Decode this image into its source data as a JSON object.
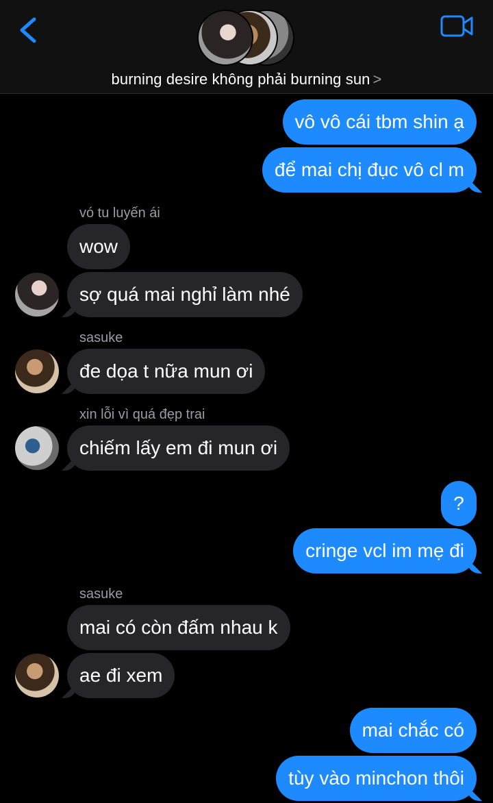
{
  "header": {
    "title": "burning desire không phải burning sun",
    "chevron": ">",
    "back_icon": "chevron-left-icon",
    "video_icon": "video-camera-icon",
    "accent": "#1d8bff"
  },
  "messages": [
    {
      "dir": "out",
      "text": "vô vô cái tbm shin ạ"
    },
    {
      "dir": "out",
      "text": "để mai chị đục vô cl m"
    },
    {
      "dir": "in",
      "sender": "vó tu luyến ái",
      "text": "wow"
    },
    {
      "dir": "in",
      "text": "sợ quá mai nghỉ làm nhé"
    },
    {
      "dir": "in",
      "sender": "sasuke",
      "text": "đe dọa t nữa mun ơi"
    },
    {
      "dir": "in",
      "sender": "xin lỗi vì quá đẹp trai",
      "text": "chiếm lấy em đi mun ơi"
    },
    {
      "dir": "out",
      "text": "?"
    },
    {
      "dir": "out",
      "text": "cringe vcl im mẹ đi"
    },
    {
      "dir": "in",
      "sender": "sasuke",
      "text": "mai có còn đấm nhau k"
    },
    {
      "dir": "in",
      "text": "ae đi xem"
    },
    {
      "dir": "out",
      "text": "mai chắc có"
    },
    {
      "dir": "out",
      "text": "tùy vào minchon thôi"
    }
  ]
}
